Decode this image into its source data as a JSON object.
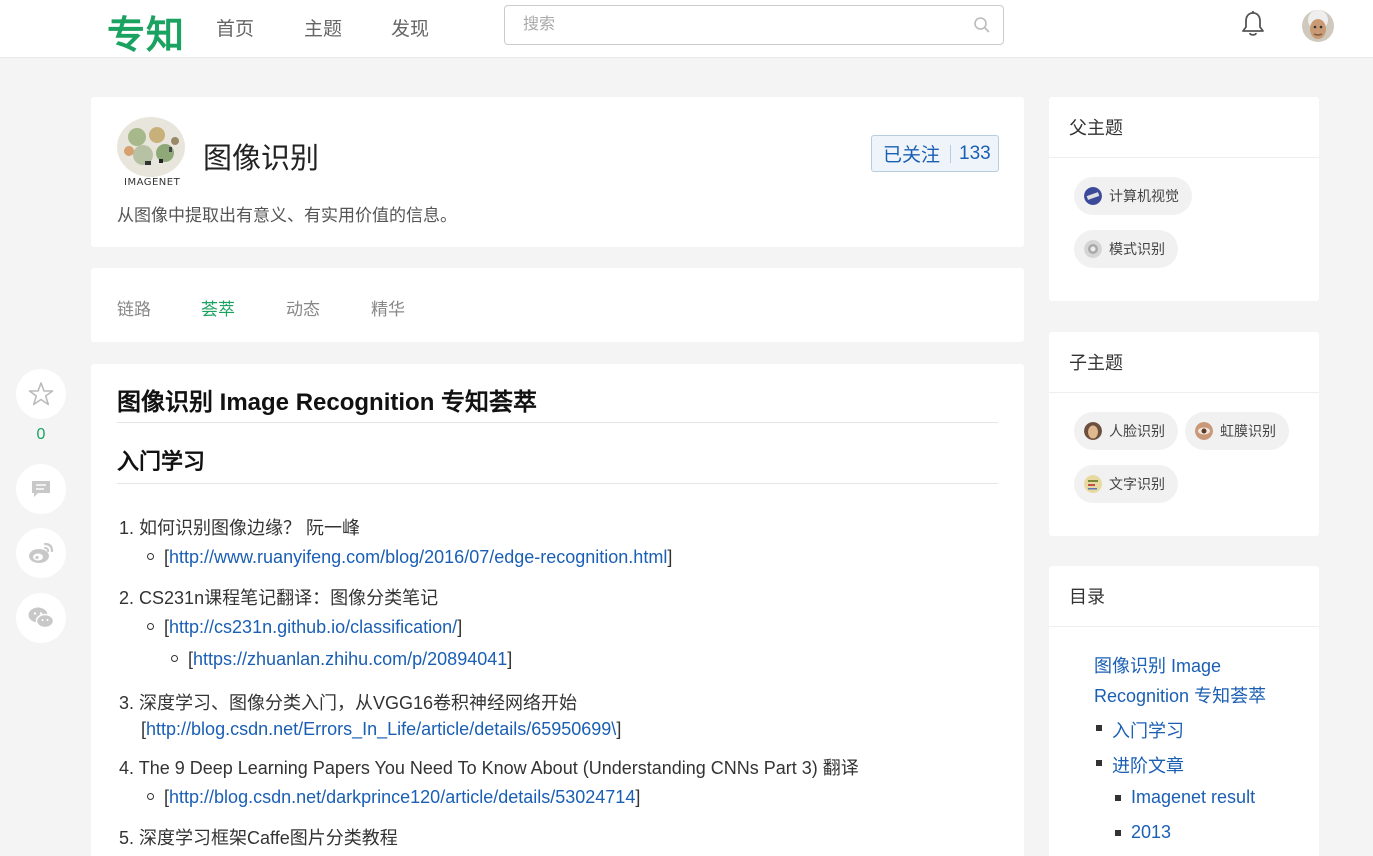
{
  "header": {
    "logo": "专知",
    "nav": [
      "首页",
      "主题",
      "发现"
    ],
    "search_placeholder": "搜索"
  },
  "topic": {
    "logo_caption": "IMAGENET",
    "title": "图像识别",
    "follow_label": "已关注",
    "follow_count": "133",
    "description": "从图像中提取出有意义、有实用价值的信息。"
  },
  "tabs": [
    "链路",
    "荟萃",
    "动态",
    "精华"
  ],
  "active_tab": "荟萃",
  "side_actions": {
    "star_count": "0"
  },
  "content": {
    "title": "图像识别 Image Recognition 专知荟萃",
    "section": "入门学习",
    "items": [
      {
        "num": "1.",
        "text": "如何识别图像边缘？ 阮一峰"
      },
      {
        "link": "http://www.ruanyifeng.com/blog/2016/07/edge-recognition.html"
      },
      {
        "num": "2.",
        "text": "CS231n课程笔记翻译：图像分类笔记"
      },
      {
        "link": "http://cs231n.github.io/classification/"
      },
      {
        "link": "https://zhuanlan.zhihu.com/p/20894041"
      },
      {
        "num": "3.",
        "text": "深度学习、图像分类入门，从VGG16卷积神经网络开始"
      },
      {
        "link": "http://blog.csdn.net/Errors_In_Life/article/details/65950699\\"
      },
      {
        "num": "4.",
        "text": " The 9 Deep Learning Papers You Need To Know About (Understanding CNNs Part 3) 翻译"
      },
      {
        "link": "http://blog.csdn.net/darkprince120/article/details/53024714"
      },
      {
        "num": "5.",
        "text": "深度学习框架Caffe图片分类教程"
      }
    ]
  },
  "sidebar": {
    "parent_title": "父主题",
    "parents": [
      "计算机视觉",
      "模式识别"
    ],
    "child_title": "子主题",
    "children": [
      "人脸识别",
      "虹膜识别",
      "文字识别"
    ],
    "toc_title": "目录",
    "toc": {
      "main_line1": "图像识别 Image",
      "main_line2": "Recognition 专知荟萃",
      "items": [
        "入门学习",
        "进阶文章"
      ],
      "subitems": [
        "Imagenet result",
        "2013"
      ]
    }
  },
  "colors": {
    "brand_green": "#1aa260",
    "link_blue": "#1a5fb4"
  }
}
